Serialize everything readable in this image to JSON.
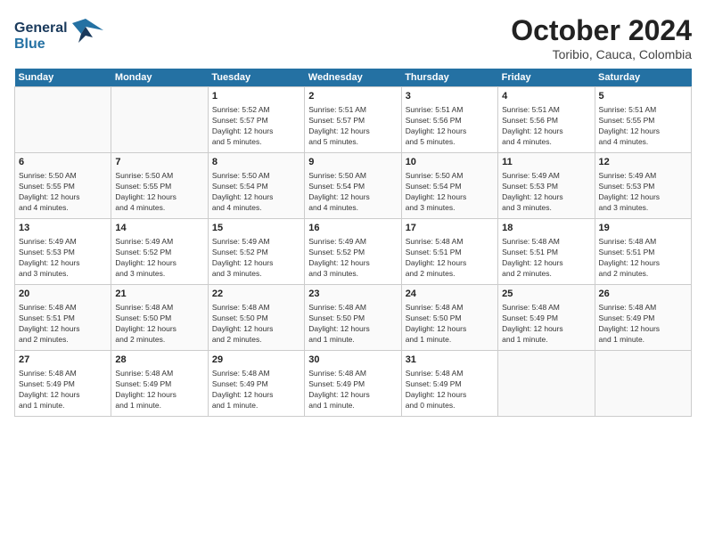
{
  "header": {
    "logo_line1": "General",
    "logo_line2": "Blue",
    "month": "October 2024",
    "location": "Toribio, Cauca, Colombia"
  },
  "days_of_week": [
    "Sunday",
    "Monday",
    "Tuesday",
    "Wednesday",
    "Thursday",
    "Friday",
    "Saturday"
  ],
  "weeks": [
    [
      {
        "day": "",
        "info": ""
      },
      {
        "day": "",
        "info": ""
      },
      {
        "day": "1",
        "info": "Sunrise: 5:52 AM\nSunset: 5:57 PM\nDaylight: 12 hours\nand 5 minutes."
      },
      {
        "day": "2",
        "info": "Sunrise: 5:51 AM\nSunset: 5:57 PM\nDaylight: 12 hours\nand 5 minutes."
      },
      {
        "day": "3",
        "info": "Sunrise: 5:51 AM\nSunset: 5:56 PM\nDaylight: 12 hours\nand 5 minutes."
      },
      {
        "day": "4",
        "info": "Sunrise: 5:51 AM\nSunset: 5:56 PM\nDaylight: 12 hours\nand 4 minutes."
      },
      {
        "day": "5",
        "info": "Sunrise: 5:51 AM\nSunset: 5:55 PM\nDaylight: 12 hours\nand 4 minutes."
      }
    ],
    [
      {
        "day": "6",
        "info": "Sunrise: 5:50 AM\nSunset: 5:55 PM\nDaylight: 12 hours\nand 4 minutes."
      },
      {
        "day": "7",
        "info": "Sunrise: 5:50 AM\nSunset: 5:55 PM\nDaylight: 12 hours\nand 4 minutes."
      },
      {
        "day": "8",
        "info": "Sunrise: 5:50 AM\nSunset: 5:54 PM\nDaylight: 12 hours\nand 4 minutes."
      },
      {
        "day": "9",
        "info": "Sunrise: 5:50 AM\nSunset: 5:54 PM\nDaylight: 12 hours\nand 4 minutes."
      },
      {
        "day": "10",
        "info": "Sunrise: 5:50 AM\nSunset: 5:54 PM\nDaylight: 12 hours\nand 3 minutes."
      },
      {
        "day": "11",
        "info": "Sunrise: 5:49 AM\nSunset: 5:53 PM\nDaylight: 12 hours\nand 3 minutes."
      },
      {
        "day": "12",
        "info": "Sunrise: 5:49 AM\nSunset: 5:53 PM\nDaylight: 12 hours\nand 3 minutes."
      }
    ],
    [
      {
        "day": "13",
        "info": "Sunrise: 5:49 AM\nSunset: 5:53 PM\nDaylight: 12 hours\nand 3 minutes."
      },
      {
        "day": "14",
        "info": "Sunrise: 5:49 AM\nSunset: 5:52 PM\nDaylight: 12 hours\nand 3 minutes."
      },
      {
        "day": "15",
        "info": "Sunrise: 5:49 AM\nSunset: 5:52 PM\nDaylight: 12 hours\nand 3 minutes."
      },
      {
        "day": "16",
        "info": "Sunrise: 5:49 AM\nSunset: 5:52 PM\nDaylight: 12 hours\nand 3 minutes."
      },
      {
        "day": "17",
        "info": "Sunrise: 5:48 AM\nSunset: 5:51 PM\nDaylight: 12 hours\nand 2 minutes."
      },
      {
        "day": "18",
        "info": "Sunrise: 5:48 AM\nSunset: 5:51 PM\nDaylight: 12 hours\nand 2 minutes."
      },
      {
        "day": "19",
        "info": "Sunrise: 5:48 AM\nSunset: 5:51 PM\nDaylight: 12 hours\nand 2 minutes."
      }
    ],
    [
      {
        "day": "20",
        "info": "Sunrise: 5:48 AM\nSunset: 5:51 PM\nDaylight: 12 hours\nand 2 minutes."
      },
      {
        "day": "21",
        "info": "Sunrise: 5:48 AM\nSunset: 5:50 PM\nDaylight: 12 hours\nand 2 minutes."
      },
      {
        "day": "22",
        "info": "Sunrise: 5:48 AM\nSunset: 5:50 PM\nDaylight: 12 hours\nand 2 minutes."
      },
      {
        "day": "23",
        "info": "Sunrise: 5:48 AM\nSunset: 5:50 PM\nDaylight: 12 hours\nand 1 minute."
      },
      {
        "day": "24",
        "info": "Sunrise: 5:48 AM\nSunset: 5:50 PM\nDaylight: 12 hours\nand 1 minute."
      },
      {
        "day": "25",
        "info": "Sunrise: 5:48 AM\nSunset: 5:49 PM\nDaylight: 12 hours\nand 1 minute."
      },
      {
        "day": "26",
        "info": "Sunrise: 5:48 AM\nSunset: 5:49 PM\nDaylight: 12 hours\nand 1 minute."
      }
    ],
    [
      {
        "day": "27",
        "info": "Sunrise: 5:48 AM\nSunset: 5:49 PM\nDaylight: 12 hours\nand 1 minute."
      },
      {
        "day": "28",
        "info": "Sunrise: 5:48 AM\nSunset: 5:49 PM\nDaylight: 12 hours\nand 1 minute."
      },
      {
        "day": "29",
        "info": "Sunrise: 5:48 AM\nSunset: 5:49 PM\nDaylight: 12 hours\nand 1 minute."
      },
      {
        "day": "30",
        "info": "Sunrise: 5:48 AM\nSunset: 5:49 PM\nDaylight: 12 hours\nand 1 minute."
      },
      {
        "day": "31",
        "info": "Sunrise: 5:48 AM\nSunset: 5:49 PM\nDaylight: 12 hours\nand 0 minutes."
      },
      {
        "day": "",
        "info": ""
      },
      {
        "day": "",
        "info": ""
      }
    ]
  ]
}
